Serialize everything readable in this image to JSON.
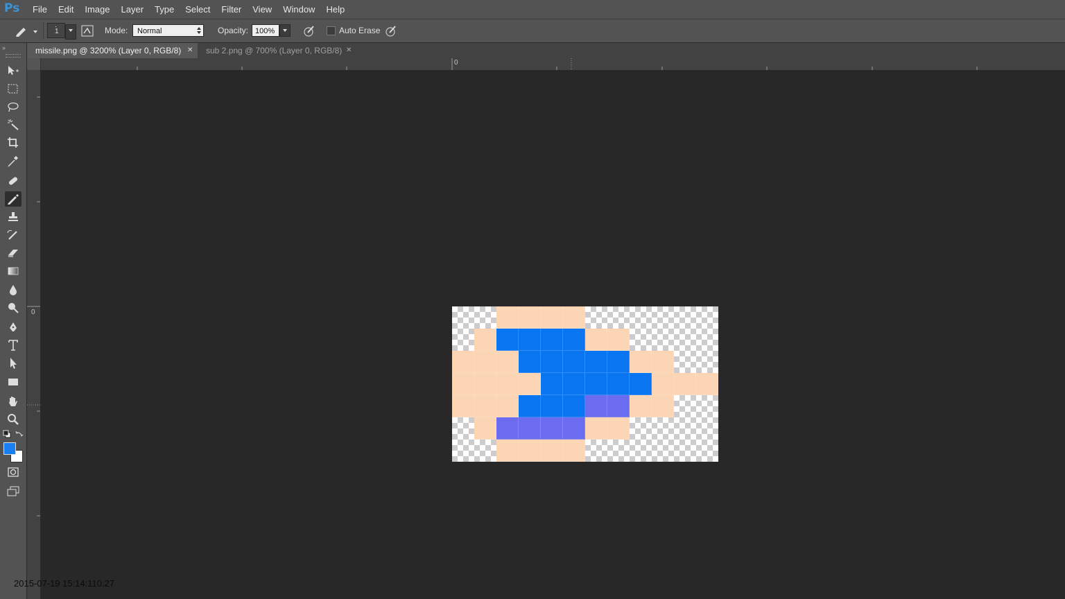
{
  "app": {
    "logo": "Ps"
  },
  "menu": [
    "File",
    "Edit",
    "Image",
    "Layer",
    "Type",
    "Select",
    "Filter",
    "View",
    "Window",
    "Help"
  ],
  "options": {
    "brush_size": "1",
    "mode_label": "Mode:",
    "mode_value": "Normal",
    "opacity_label": "Opacity:",
    "opacity_value": "100%",
    "auto_erase_label": "Auto Erase",
    "auto_erase_checked": false
  },
  "tabs": [
    {
      "label": "missile.png @ 3200% (Layer 0, RGB/8)",
      "active": true
    },
    {
      "label": "sub 2.png @ 700% (Layer 0, RGB/8)",
      "active": false
    }
  ],
  "rulers": {
    "h_zero": "0",
    "v_zero": "0"
  },
  "tools": [
    "move-tool-icon",
    "marquee-tool-icon",
    "lasso-tool-icon",
    "magic-wand-tool-icon",
    "crop-tool-icon",
    "eyedropper-tool-icon",
    "healing-brush-tool-icon",
    "pencil-tool-icon",
    "clone-stamp-tool-icon",
    "history-brush-tool-icon",
    "eraser-tool-icon",
    "gradient-tool-icon",
    "blur-tool-icon",
    "dodge-tool-icon",
    "pen-tool-icon",
    "type-tool-icon",
    "path-selection-tool-icon",
    "rectangle-tool-icon",
    "hand-tool-icon",
    "zoom-tool-icon"
  ],
  "active_tool": "pencil-tool-icon",
  "colors": {
    "foreground": "#1a7ff0",
    "background": "#ffffff"
  },
  "image": {
    "palette": {
      "s": "#fcd5b5",
      "b": "#0a75f0",
      "p": "#6c6cf0",
      ".": "transparent"
    },
    "rows": [
      "..ssss......",
      ".sbbbbss....",
      "sssbbbbbss..",
      "ssssbbbbbsss",
      "sssbbbppss..",
      ".sppppss....",
      "..ssss......"
    ]
  },
  "timestamp": "2015-07-19 15:14:110.27"
}
